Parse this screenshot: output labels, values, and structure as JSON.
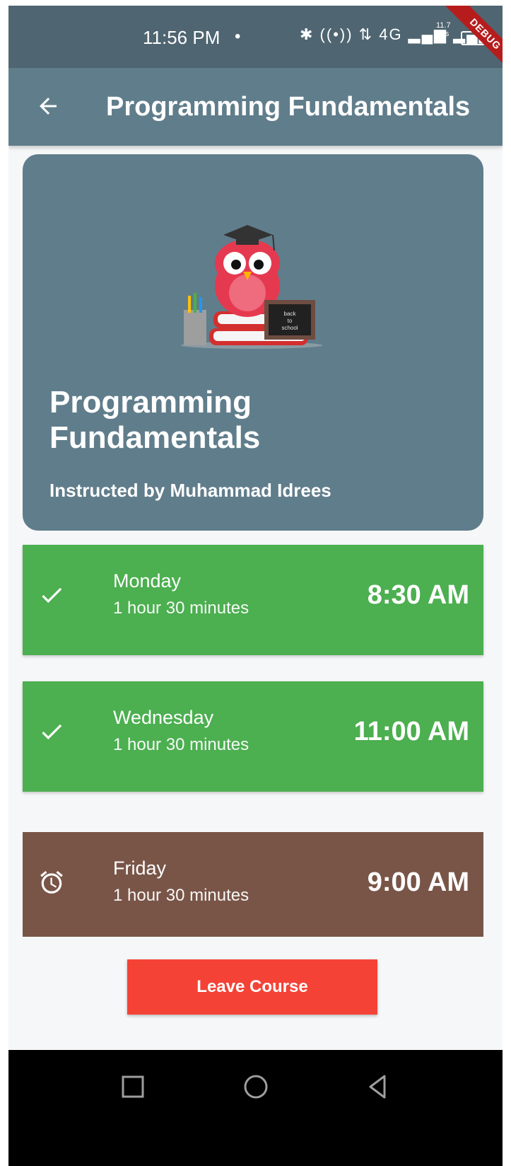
{
  "status_bar": {
    "time": "11:56 PM",
    "dot": "•",
    "icons_text": "✱ ((•)) ⇅ 4G ▂▄▆ ▂▄▆",
    "speed_value": "11.7",
    "speed_unit": "K/s",
    "debug_label": "DEBUG"
  },
  "app_bar": {
    "back_icon": "arrow-back-icon",
    "title": "Programming Fundamentals"
  },
  "course": {
    "title": "Programming Fundamentals",
    "instructor": "Instructed by Muhammad Idrees",
    "card_color": "#607d8b",
    "illustration_text": "back to school"
  },
  "schedule": [
    {
      "day": "Monday",
      "duration": "1 hour 30 minutes",
      "time": "8:30 AM",
      "icon": "check-icon",
      "color": "#4caf50"
    },
    {
      "day": "Wednesday",
      "duration": "1 hour 30 minutes",
      "time": "11:00 AM",
      "icon": "check-icon",
      "color": "#4caf50"
    },
    {
      "day": "Friday",
      "duration": "1 hour 30 minutes",
      "time": "9:00 AM",
      "icon": "alarm-icon",
      "color": "#795548"
    }
  ],
  "actions": {
    "leave_label": "Leave Course",
    "leave_color": "#f44336"
  },
  "nav": {
    "recents_icon": "square-recents-icon",
    "home_icon": "circle-home-icon",
    "back_icon": "triangle-back-icon"
  }
}
